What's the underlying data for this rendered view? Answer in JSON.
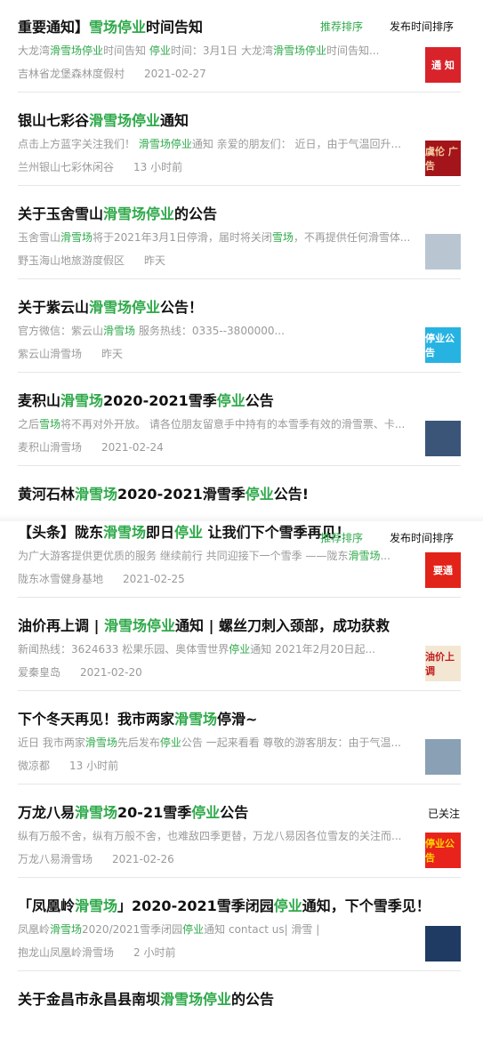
{
  "sort_top": {
    "recommended": "推荐排序",
    "publish_time": "发布时间排序"
  },
  "sort_mid": {
    "recommended": "推荐排序",
    "publish_time": "发布时间排序"
  },
  "followed_label": "已关注",
  "results": [
    {
      "title": [
        {
          "t": "重要通知】",
          "h": false
        },
        {
          "t": "雪场停业",
          "h": true
        },
        {
          "t": "时间告知",
          "h": false
        }
      ],
      "snippet": [
        {
          "t": "大龙湾",
          "h": false
        },
        {
          "t": "滑雪场停业",
          "h": true
        },
        {
          "t": "时间告知 ",
          "h": false
        },
        {
          "t": "停业",
          "h": true
        },
        {
          "t": "时间：3月1日 大龙湾",
          "h": false
        },
        {
          "t": "滑雪场停业",
          "h": true
        },
        {
          "t": "时间告知...",
          "h": false
        }
      ],
      "source": "吉林省龙堡森林度假村",
      "time": "2021-02-27",
      "thumb": {
        "text": "通 知",
        "bg": "#d8232a",
        "fg": "#ffffff"
      }
    },
    {
      "title": [
        {
          "t": "银山七彩谷",
          "h": false
        },
        {
          "t": "滑雪场停业",
          "h": true
        },
        {
          "t": "通知",
          "h": false
        }
      ],
      "snippet": [
        {
          "t": "点击上方蓝字关注我们！ ",
          "h": false
        },
        {
          "t": "滑雪场停业",
          "h": true
        },
        {
          "t": "通知 亲爱的朋友们： 近日，由于气温回升...",
          "h": false
        }
      ],
      "source": "兰州银山七彩休闲谷",
      "time": "13 小时前",
      "thumb": {
        "text": "虞伦 广告",
        "bg": "#a3151a",
        "fg": "#f4c9a0"
      }
    },
    {
      "title": [
        {
          "t": "关于玉舍雪山",
          "h": false
        },
        {
          "t": "滑雪场停业",
          "h": true
        },
        {
          "t": "的公告",
          "h": false
        }
      ],
      "snippet": [
        {
          "t": "玉舍雪山",
          "h": false
        },
        {
          "t": "滑雪场",
          "h": true
        },
        {
          "t": "将于2021年3月1日停滑，届时将关闭",
          "h": false
        },
        {
          "t": "雪场",
          "h": true
        },
        {
          "t": "，不再提供任何滑雪体...",
          "h": false
        }
      ],
      "source": "野玉海山地旅游度假区",
      "time": "昨天",
      "thumb": {
        "text": "",
        "bg": "#b9c6d2",
        "fg": "#ffffff"
      }
    },
    {
      "title": [
        {
          "t": "关于紫云山",
          "h": false
        },
        {
          "t": "滑雪场停业",
          "h": true
        },
        {
          "t": "公告！",
          "h": false
        }
      ],
      "snippet": [
        {
          "t": "官方微信：紫云山",
          "h": false
        },
        {
          "t": "滑雪场",
          "h": true
        },
        {
          "t": " 服务热线：0335--3800000...",
          "h": false
        }
      ],
      "source": "紫云山滑雪场",
      "time": "昨天",
      "thumb": {
        "text": "停业公告",
        "bg": "#27b3e2",
        "fg": "#ffffff"
      }
    },
    {
      "title": [
        {
          "t": "麦积山",
          "h": false
        },
        {
          "t": "滑雪场",
          "h": true
        },
        {
          "t": "2020-2021雪季",
          "h": false
        },
        {
          "t": "停业",
          "h": true
        },
        {
          "t": "公告",
          "h": false
        }
      ],
      "snippet": [
        {
          "t": "之后",
          "h": false
        },
        {
          "t": "雪场",
          "h": true
        },
        {
          "t": "将不再对外开放。 请各位朋友留意手中持有的本雪季有效的滑雪票、卡...",
          "h": false
        }
      ],
      "source": "麦积山滑雪场",
      "time": "2021-02-24",
      "thumb": {
        "text": "",
        "bg": "#3a5578",
        "fg": "#ffffff"
      }
    },
    {
      "title": [
        {
          "t": "黄河石林",
          "h": false
        },
        {
          "t": "滑雪场",
          "h": true
        },
        {
          "t": "2020-2021滑雪季",
          "h": false
        },
        {
          "t": "停业",
          "h": true
        },
        {
          "t": "公告!",
          "h": false
        }
      ],
      "snippet": [],
      "source": "",
      "time": "",
      "thumb": null
    },
    {
      "title": [
        {
          "t": "【头条】陇东",
          "h": false
        },
        {
          "t": "滑雪场",
          "h": true
        },
        {
          "t": "即日",
          "h": false
        },
        {
          "t": "停业",
          "h": true
        },
        {
          "t": " 让我们下个雪季再见！",
          "h": false
        }
      ],
      "snippet": [
        {
          "t": "为广大游客提供更优质的服务 继续前行 共同迎接下一个雪季 ——陇东",
          "h": false
        },
        {
          "t": "滑雪场",
          "h": true
        },
        {
          "t": "...",
          "h": false
        }
      ],
      "source": "陇东冰雪健身基地",
      "time": "2021-02-25",
      "thumb": {
        "text": "要通",
        "bg": "#e2231a",
        "fg": "#ffffff"
      }
    },
    {
      "title": [
        {
          "t": "油价再上调 | ",
          "h": false
        },
        {
          "t": "滑雪场停业",
          "h": true
        },
        {
          "t": "通知 | 螺丝刀刺入颈部，成功获救",
          "h": false
        }
      ],
      "snippet": [
        {
          "t": "新闻热线：3624633 松果乐园、奥体雪世界",
          "h": false
        },
        {
          "t": "停业",
          "h": true
        },
        {
          "t": "通知 2021年2月20日起...",
          "h": false
        }
      ],
      "source": "爱秦皇岛",
      "time": "2021-02-20",
      "thumb": {
        "text": "油价上调",
        "bg": "#f3e7d3",
        "fg": "#c21b1b"
      }
    },
    {
      "title": [
        {
          "t": "下个冬天再见！我市两家",
          "h": false
        },
        {
          "t": "滑雪场",
          "h": true
        },
        {
          "t": "停滑~",
          "h": false
        }
      ],
      "snippet": [
        {
          "t": "近日 我市两家",
          "h": false
        },
        {
          "t": "滑雪场",
          "h": true
        },
        {
          "t": "先后发布",
          "h": false
        },
        {
          "t": "停业",
          "h": true
        },
        {
          "t": "公告 一起来看看 尊敬的游客朋友：由于气温...",
          "h": false
        }
      ],
      "source": "微凉都",
      "time": "13 小时前",
      "thumb": {
        "text": "",
        "bg": "#8aa0b4",
        "fg": "#ffffff"
      }
    },
    {
      "title": [
        {
          "t": "万龙八易",
          "h": false
        },
        {
          "t": "滑雪场",
          "h": true
        },
        {
          "t": "20-21雪季",
          "h": false
        },
        {
          "t": "停业",
          "h": true
        },
        {
          "t": "公告",
          "h": false
        }
      ],
      "snippet": [
        {
          "t": "纵有万般不舍，纵有万般不舍，也难敌四季更替，万龙八易因各位雪友的关注而...",
          "h": false
        }
      ],
      "source": "万龙八易滑雪场",
      "time": "2021-02-26",
      "thumb": {
        "text": "停业公告",
        "bg": "#e8231c",
        "fg": "#ffd400"
      }
    },
    {
      "title": [
        {
          "t": "「凤凰岭",
          "h": false
        },
        {
          "t": "滑雪场",
          "h": true
        },
        {
          "t": "」2020-2021雪季闭园",
          "h": false
        },
        {
          "t": "停业",
          "h": true
        },
        {
          "t": "通知，下个雪季见！",
          "h": false
        }
      ],
      "snippet": [
        {
          "t": "凤凰岭",
          "h": false
        },
        {
          "t": "滑雪场",
          "h": true
        },
        {
          "t": "2020/2021雪季闭园",
          "h": false
        },
        {
          "t": "停业",
          "h": true
        },
        {
          "t": "通知 contact us| 滑雪 |",
          "h": false
        }
      ],
      "source": "抱龙山凤凰岭滑雪场",
      "time": "2 小时前",
      "thumb": {
        "text": "",
        "bg": "#1f3b63",
        "fg": "#ffffff"
      }
    },
    {
      "title": [
        {
          "t": "关于金昌市永昌县南坝",
          "h": false
        },
        {
          "t": "滑雪场停业",
          "h": true
        },
        {
          "t": "的公告",
          "h": false
        }
      ],
      "snippet": [],
      "source": "",
      "time": "",
      "thumb": null
    }
  ]
}
